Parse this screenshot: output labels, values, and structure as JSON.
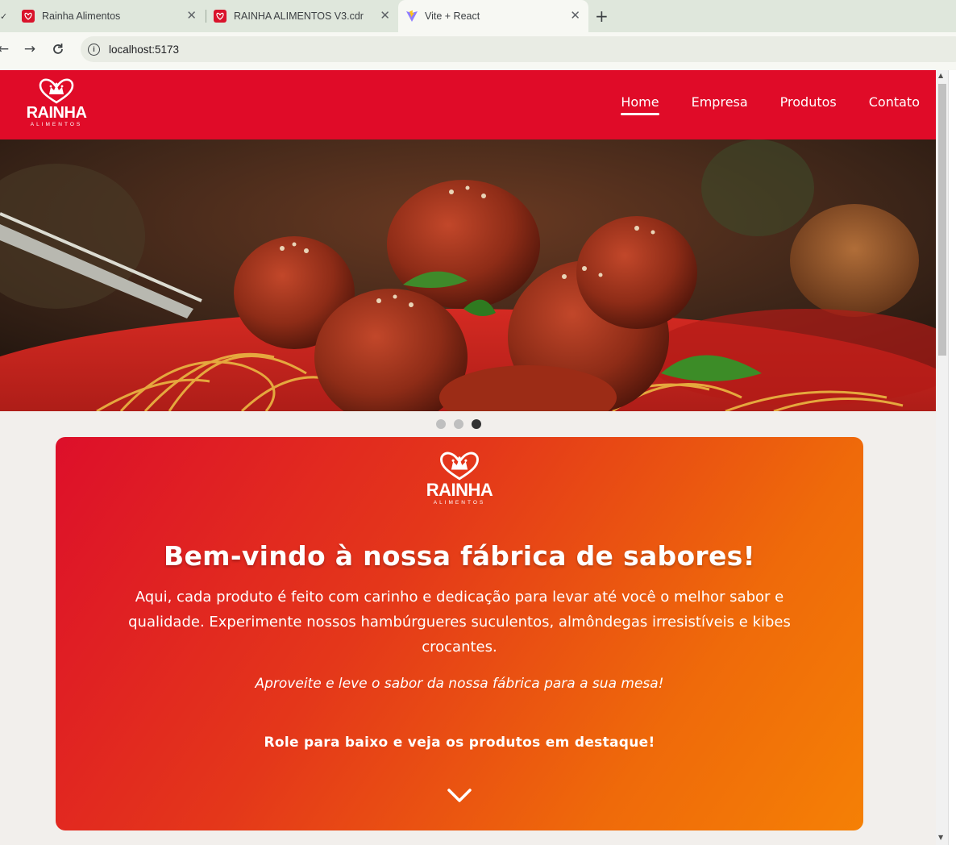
{
  "browser": {
    "tabs": [
      {
        "title": "Rainha Alimentos",
        "active": false
      },
      {
        "title": "RAINHA ALIMENTOS V3.cdr",
        "active": false
      },
      {
        "title": "Vite + React",
        "active": true
      }
    ],
    "url": "localhost:5173",
    "icons": {
      "back": "arrow-left-icon",
      "forward": "arrow-right-icon",
      "reload": "reload-icon",
      "info": "site-info-icon",
      "new_tab": "plus-icon",
      "close": "close-icon"
    }
  },
  "site": {
    "logo": {
      "brand": "RAINHA",
      "sub": "ALIMENTOS"
    },
    "nav": [
      {
        "label": "Home",
        "active": true
      },
      {
        "label": "Empresa",
        "active": false
      },
      {
        "label": "Produtos",
        "active": false
      },
      {
        "label": "Contato",
        "active": false
      }
    ],
    "carousel": {
      "slides": 3,
      "active_index": 2
    },
    "welcome": {
      "title": "Bem-vindo à nossa fábrica de sabores!",
      "description": "Aqui, cada produto é feito com carinho e dedicação para levar até você o melhor sabor e qualidade. Experimente nossos hambúrgueres suculentos, almôndegas irresistíveis e kibes crocantes.",
      "tagline": "Aproveite e leve o sabor da nossa fábrica para a sua mesa!",
      "cta": "Role para baixo e veja os produtos em destaque!"
    }
  },
  "colors": {
    "brand_red": "#e00b28",
    "gradient_start": "#dd0f2a",
    "gradient_end": "#f58005",
    "page_bg": "#f2efec"
  }
}
